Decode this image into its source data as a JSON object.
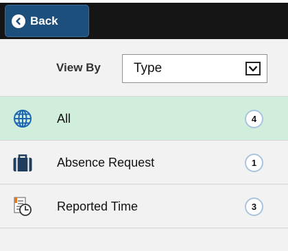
{
  "header": {
    "back_label": "Back"
  },
  "filter": {
    "label": "View By",
    "selected": "Type"
  },
  "list": {
    "items": [
      {
        "label": "All",
        "count": "4",
        "icon": "globe-icon",
        "selected": true
      },
      {
        "label": "Absence Request",
        "count": "1",
        "icon": "briefcase-icon",
        "selected": false
      },
      {
        "label": "Reported Time",
        "count": "3",
        "icon": "timesheet-clock-icon",
        "selected": false
      }
    ]
  },
  "colors": {
    "back_button": "#1d4f7c",
    "top_bar": "#151515",
    "selected_row": "#d1eddc",
    "globe_icon": "#1a66b3",
    "badge_border": "#a9c4de"
  }
}
